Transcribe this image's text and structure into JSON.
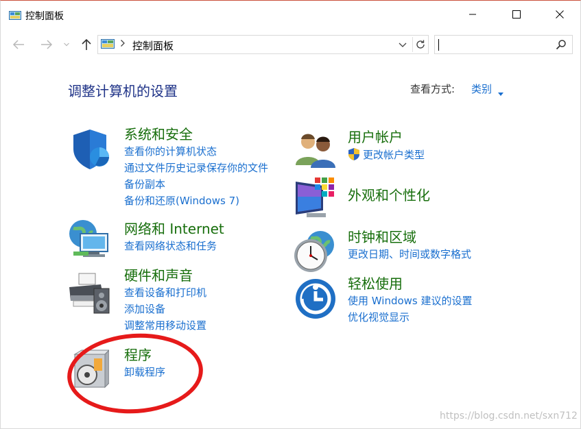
{
  "window": {
    "title": "控制面板"
  },
  "address_bar": {
    "breadcrumb": "控制面板"
  },
  "search": {
    "value": ""
  },
  "main": {
    "heading": "调整计算机的设置",
    "view_by_label": "查看方式:",
    "view_by_value": "类别"
  },
  "categories": [
    {
      "title": "系统和安全",
      "links": [
        "查看你的计算机状态",
        "通过文件历史记录保存你的文件",
        "备份副本",
        "备份和还原(Windows 7)"
      ]
    },
    {
      "title": "网络和 Internet",
      "links": [
        "查看网络状态和任务"
      ]
    },
    {
      "title": "硬件和声音",
      "links": [
        "查看设备和打印机",
        "添加设备",
        "调整常用移动设置"
      ]
    },
    {
      "title": "程序",
      "links": [
        "卸载程序"
      ]
    },
    {
      "title": "用户帐户",
      "links": [
        "更改帐户类型"
      ]
    },
    {
      "title": "外观和个性化",
      "links": []
    },
    {
      "title": "时钟和区域",
      "links": [
        "更改日期、时间或数字格式"
      ]
    },
    {
      "title": "轻松使用",
      "links": [
        "使用 Windows 建议的设置",
        "优化视觉显示"
      ]
    }
  ],
  "watermark": "https://blog.csdn.net/sxn712",
  "colors": {
    "category_title": "#176e0c",
    "link": "#1a6fcf",
    "heading": "#1e3287",
    "annotation_circle": "#e61a1a"
  }
}
